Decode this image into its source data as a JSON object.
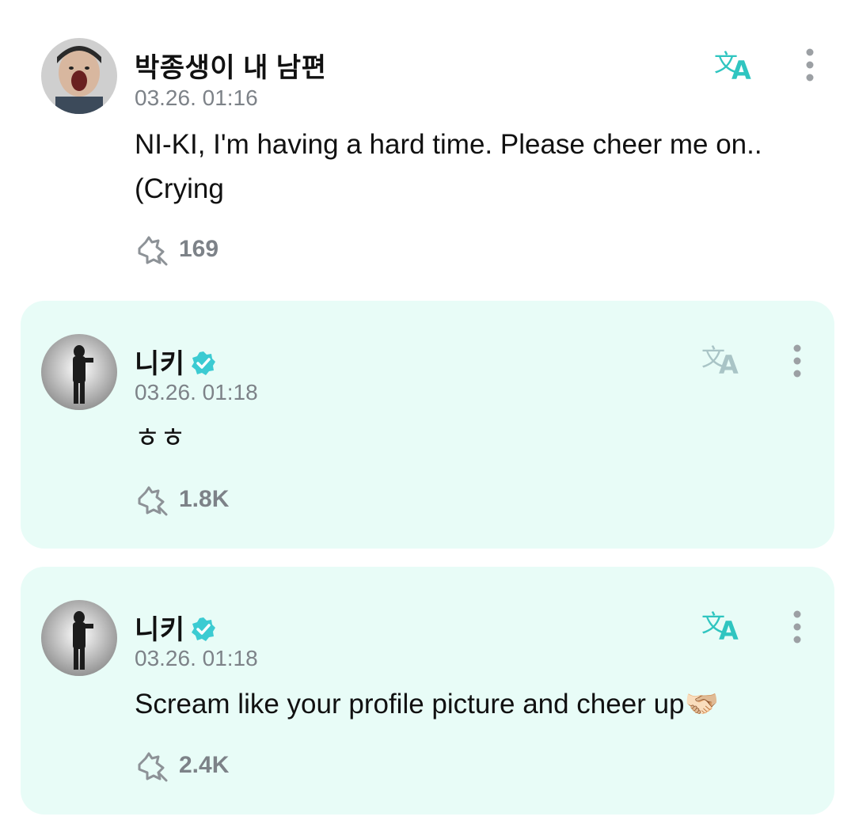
{
  "comment": {
    "author": "박종생이 내 남편",
    "timestamp": "03.26. 01:16",
    "text": "NI-KI, I'm having a hard time. Please cheer me on..(Crying",
    "likes": "169",
    "icons": [
      "avatar",
      "translate-icon",
      "more-icon",
      "cheer-icon"
    ]
  },
  "replies": [
    {
      "author": "니키",
      "verified": true,
      "timestamp": "03.26. 01:18",
      "text": "ㅎㅎ",
      "likes": "1.8K",
      "translate_color": "#a9c4c6"
    },
    {
      "author": "니키",
      "verified": true,
      "timestamp": "03.26. 01:18",
      "text": "Scream like your profile picture and cheer up🫱🏻‍🫲🏼",
      "likes": "2.4K",
      "translate_color": "#2fc5c0"
    }
  ],
  "colors": {
    "accent": "#2fc5c0",
    "reply_bg": "#e8fcf7",
    "meta_text": "#7d8288",
    "verified": "#3ccbd2"
  }
}
